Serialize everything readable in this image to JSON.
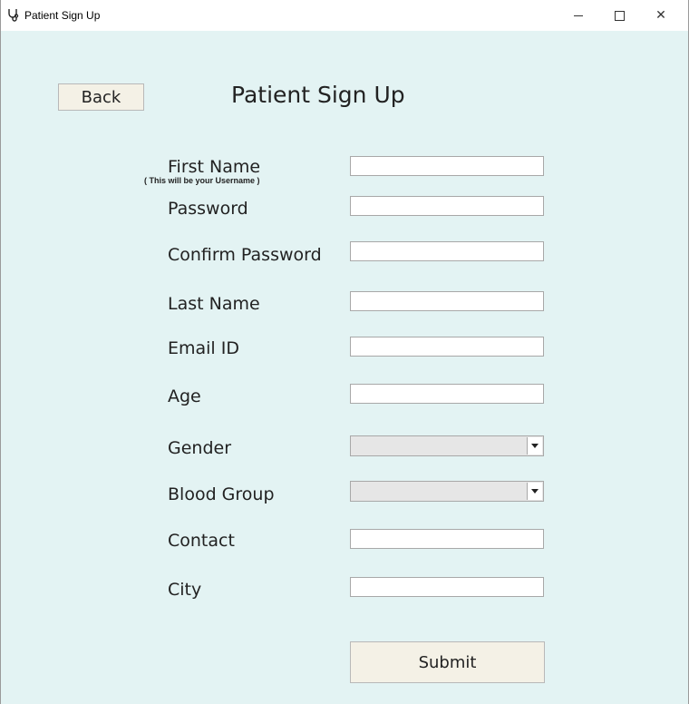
{
  "window": {
    "title": "Patient Sign Up",
    "icon": "stethoscope-icon"
  },
  "back_label": "Back",
  "page_title": "Patient Sign Up",
  "form": {
    "first_name_label": "First Name",
    "first_name_note": "( This will be your Username )",
    "password_label": "Password",
    "confirm_password_label": "Confirm Password",
    "last_name_label": "Last Name",
    "email_label": "Email ID",
    "age_label": "Age",
    "gender_label": "Gender",
    "blood_group_label": "Blood Group",
    "contact_label": "Contact",
    "city_label": "City",
    "first_name_value": "",
    "password_value": "",
    "confirm_password_value": "",
    "last_name_value": "",
    "email_value": "",
    "age_value": "",
    "gender_value": "",
    "blood_group_value": "",
    "contact_value": "",
    "city_value": ""
  },
  "submit_label": "Submit"
}
